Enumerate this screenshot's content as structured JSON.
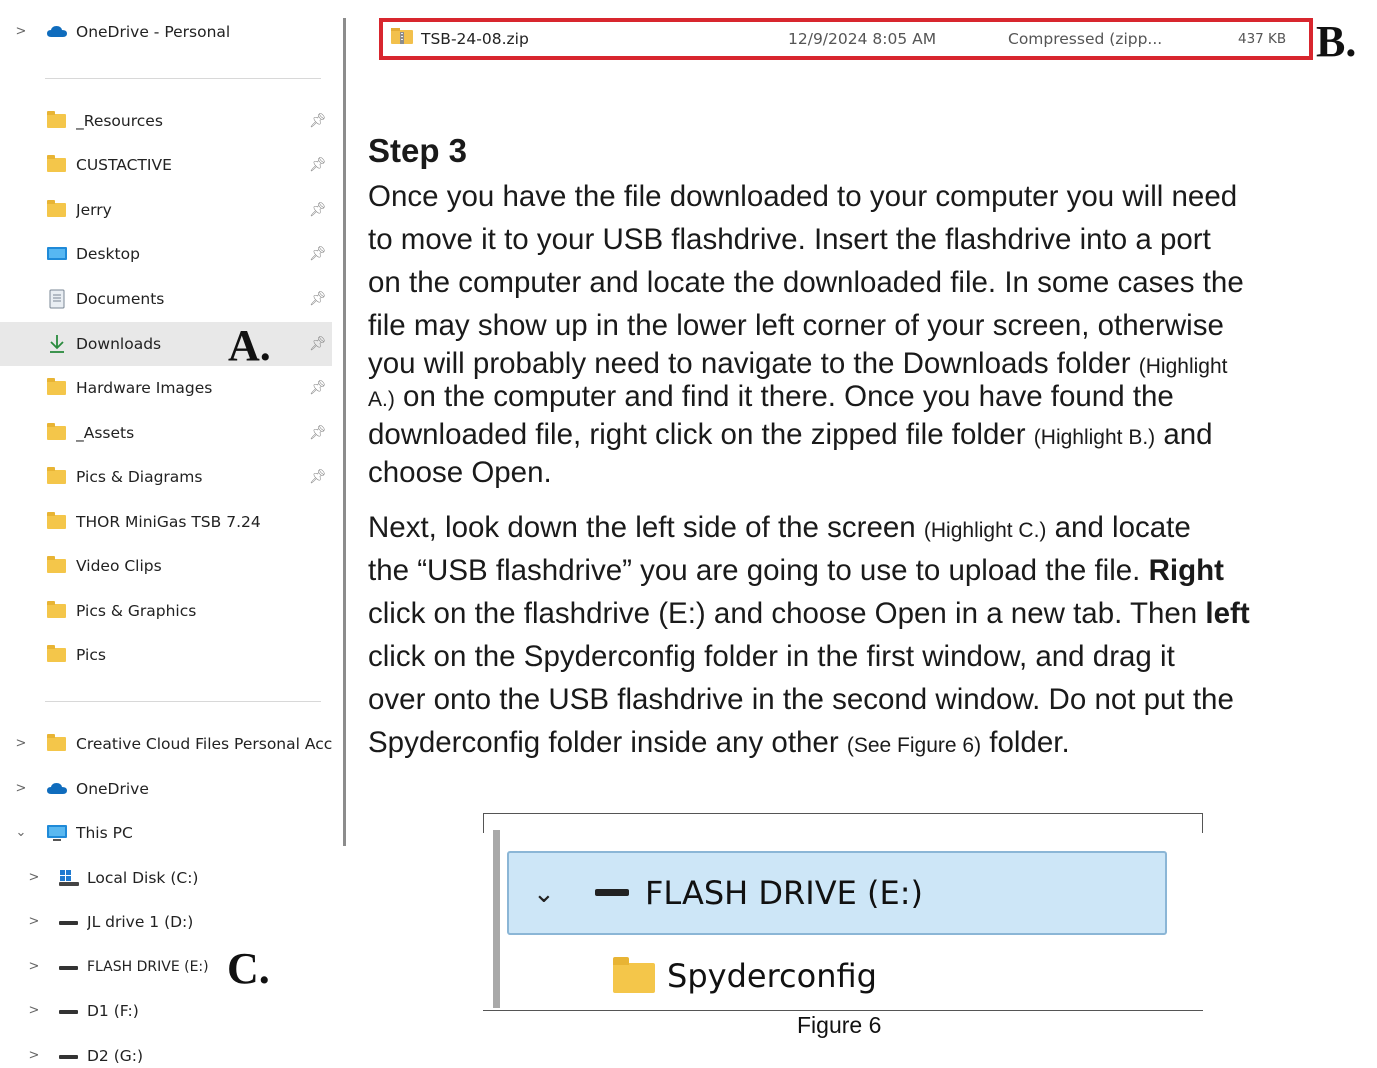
{
  "sidebar": {
    "onedrive_personal": "OneDrive - Personal",
    "quick_access": [
      {
        "label": "_Resources",
        "icon": "folder-icon"
      },
      {
        "label": "CUSTACTIVE",
        "icon": "folder-icon"
      },
      {
        "label": "Jerry",
        "icon": "folder-icon"
      },
      {
        "label": "Desktop",
        "icon": "desktop-icon"
      },
      {
        "label": "Documents",
        "icon": "documents-icon"
      },
      {
        "label": "Downloads",
        "icon": "download-arrow-icon"
      },
      {
        "label": "Hardware Images",
        "icon": "folder-icon"
      },
      {
        "label": "_Assets",
        "icon": "folder-icon"
      },
      {
        "label": "Pics & Diagrams",
        "icon": "folder-icon"
      },
      {
        "label": "THOR MiniGas TSB 7.24",
        "icon": "folder-icon"
      },
      {
        "label": "Video Clips",
        "icon": "folder-icon"
      },
      {
        "label": "Pics & Graphics",
        "icon": "folder-icon"
      },
      {
        "label": "Pics",
        "icon": "folder-icon"
      }
    ],
    "tree": [
      {
        "label": "Creative Cloud Files Personal Accou",
        "icon": "folder-icon"
      },
      {
        "label": "OneDrive",
        "icon": "cloud-icon"
      },
      {
        "label": "This PC",
        "icon": "pc-icon"
      },
      {
        "label": "Local Disk (C:)",
        "icon": "windows-drive-icon"
      },
      {
        "label": "JL drive 1 (D:)",
        "icon": "drive-icon"
      },
      {
        "label": "FLASH DRIVE (E:)",
        "icon": "drive-icon"
      },
      {
        "label": "D1 (F:)",
        "icon": "drive-icon"
      },
      {
        "label": "D2 (G:)",
        "icon": "drive-icon"
      }
    ],
    "highlight_a": "A.",
    "highlight_c": "C."
  },
  "file_row": {
    "name": "TSB-24-08.zip",
    "date": "12/9/2024 8:05 AM",
    "type": "Compressed (zipp...",
    "size": "437 KB",
    "highlight_b": "B."
  },
  "instructions": {
    "title": "Step 3",
    "p1": {
      "l1": "Once you have the file downloaded to your computer you will need",
      "l2": "to move it to your USB flashdrive. Insert the flashdrive into a port",
      "l3": "on the computer and locate the downloaded file. In some cases the",
      "l4": "file may show up in the lower left corner of your screen, otherwise",
      "l5a": "you will probably need to navigate to the Downloads folder ",
      "l5b": "(Highlight",
      "l6a": "A.)",
      "l6b": " on the computer and find it there. Once you have found the",
      "l7a": "downloaded file, right click on the zipped file folder ",
      "l7b": "(Highlight B.)",
      "l7c": " and",
      "l8": "choose Open."
    },
    "p2": {
      "l1a": "Next, look down the left side of the screen ",
      "l1b": "(Highlight C.)",
      "l1c": " and locate",
      "l2a": "the “USB flashdrive” you are going to use to upload the file. ",
      "l2b": "Right",
      "l3a": "click on the flashdrive (E:) and choose Open in a new tab. Then ",
      "l3b": "left",
      "l4": "click on the Spyderconfig folder in the first window, and drag it",
      "l5": "over onto the USB flashdrive in the second window. Do not put the",
      "l6a": "Spyderconfig folder inside any other ",
      "l6b": "(See Figure 6)",
      "l6c": " folder."
    }
  },
  "figure": {
    "drive_label": "FLASH DRIVE (E:)",
    "folder_label": "Spyderconfig",
    "caption": "Figure 6"
  },
  "colors": {
    "highlight_border": "#d8262e",
    "selected_row": "#e8e8e8",
    "figure_selection": "#cde6f7",
    "folder": "#f4c64a",
    "onedrive": "#0f6cbd"
  }
}
